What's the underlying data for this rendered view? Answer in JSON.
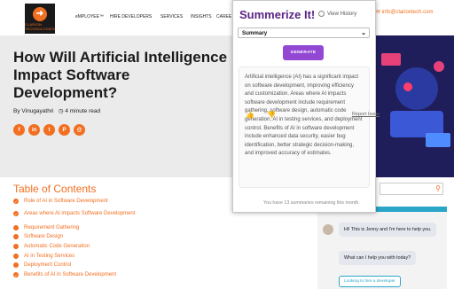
{
  "site": {
    "nav": [
      "eMPLOYEE™",
      "HIRE DEVELOPERS",
      "SERVICES",
      "INSIGHTS",
      "CAREE"
    ],
    "email": "info@clariontech.com",
    "logo_letters": "CLARION TECHNOLOGIES"
  },
  "article": {
    "title": "How Will Artificial Intelligence Impact Software Development?",
    "author_prefix": "By",
    "author": "Vinugayathri",
    "read_time": "4 minute read",
    "social": [
      "f",
      "in",
      "t",
      "P",
      "@"
    ]
  },
  "toc": {
    "title": "Table of Contents",
    "items": [
      "Role of AI in Software Development",
      "Areas where AI impacts Software Development",
      "Requirement Gathering",
      "Software Design",
      "Automatic Code Generation",
      "AI in Testing Services",
      "Deployment Control",
      "Benefits of AI in Software Development"
    ]
  },
  "chat": {
    "msg1": "Hi! This is Jenny and I'm here to help you.",
    "msg2": "What can I help you with today?",
    "button": "Looking to hire a developer"
  },
  "popup": {
    "title": "Summerize It!",
    "history": "View History",
    "select_value": "Summary",
    "generate": "GENERATE",
    "summary": "Artificial intelligence (AI) has a significant impact on software development, improving efficiency and customization. Areas where AI impacts software development include requirement gathering, software design, automatic code generation, AI in testing services, and deployment control. Benefits of AI in software development include enhanced data security, easier bug identification, better strategic decision-making, and improved accuracy of estimates.",
    "report": "Report Issue",
    "remaining": "You have 13 summaries remaining this month."
  },
  "colors": {
    "brand_orange": "#f26f21",
    "popup_purple": "#5a2384",
    "button_purple": "#9348d3",
    "chat_accent": "#2aa6c8"
  }
}
